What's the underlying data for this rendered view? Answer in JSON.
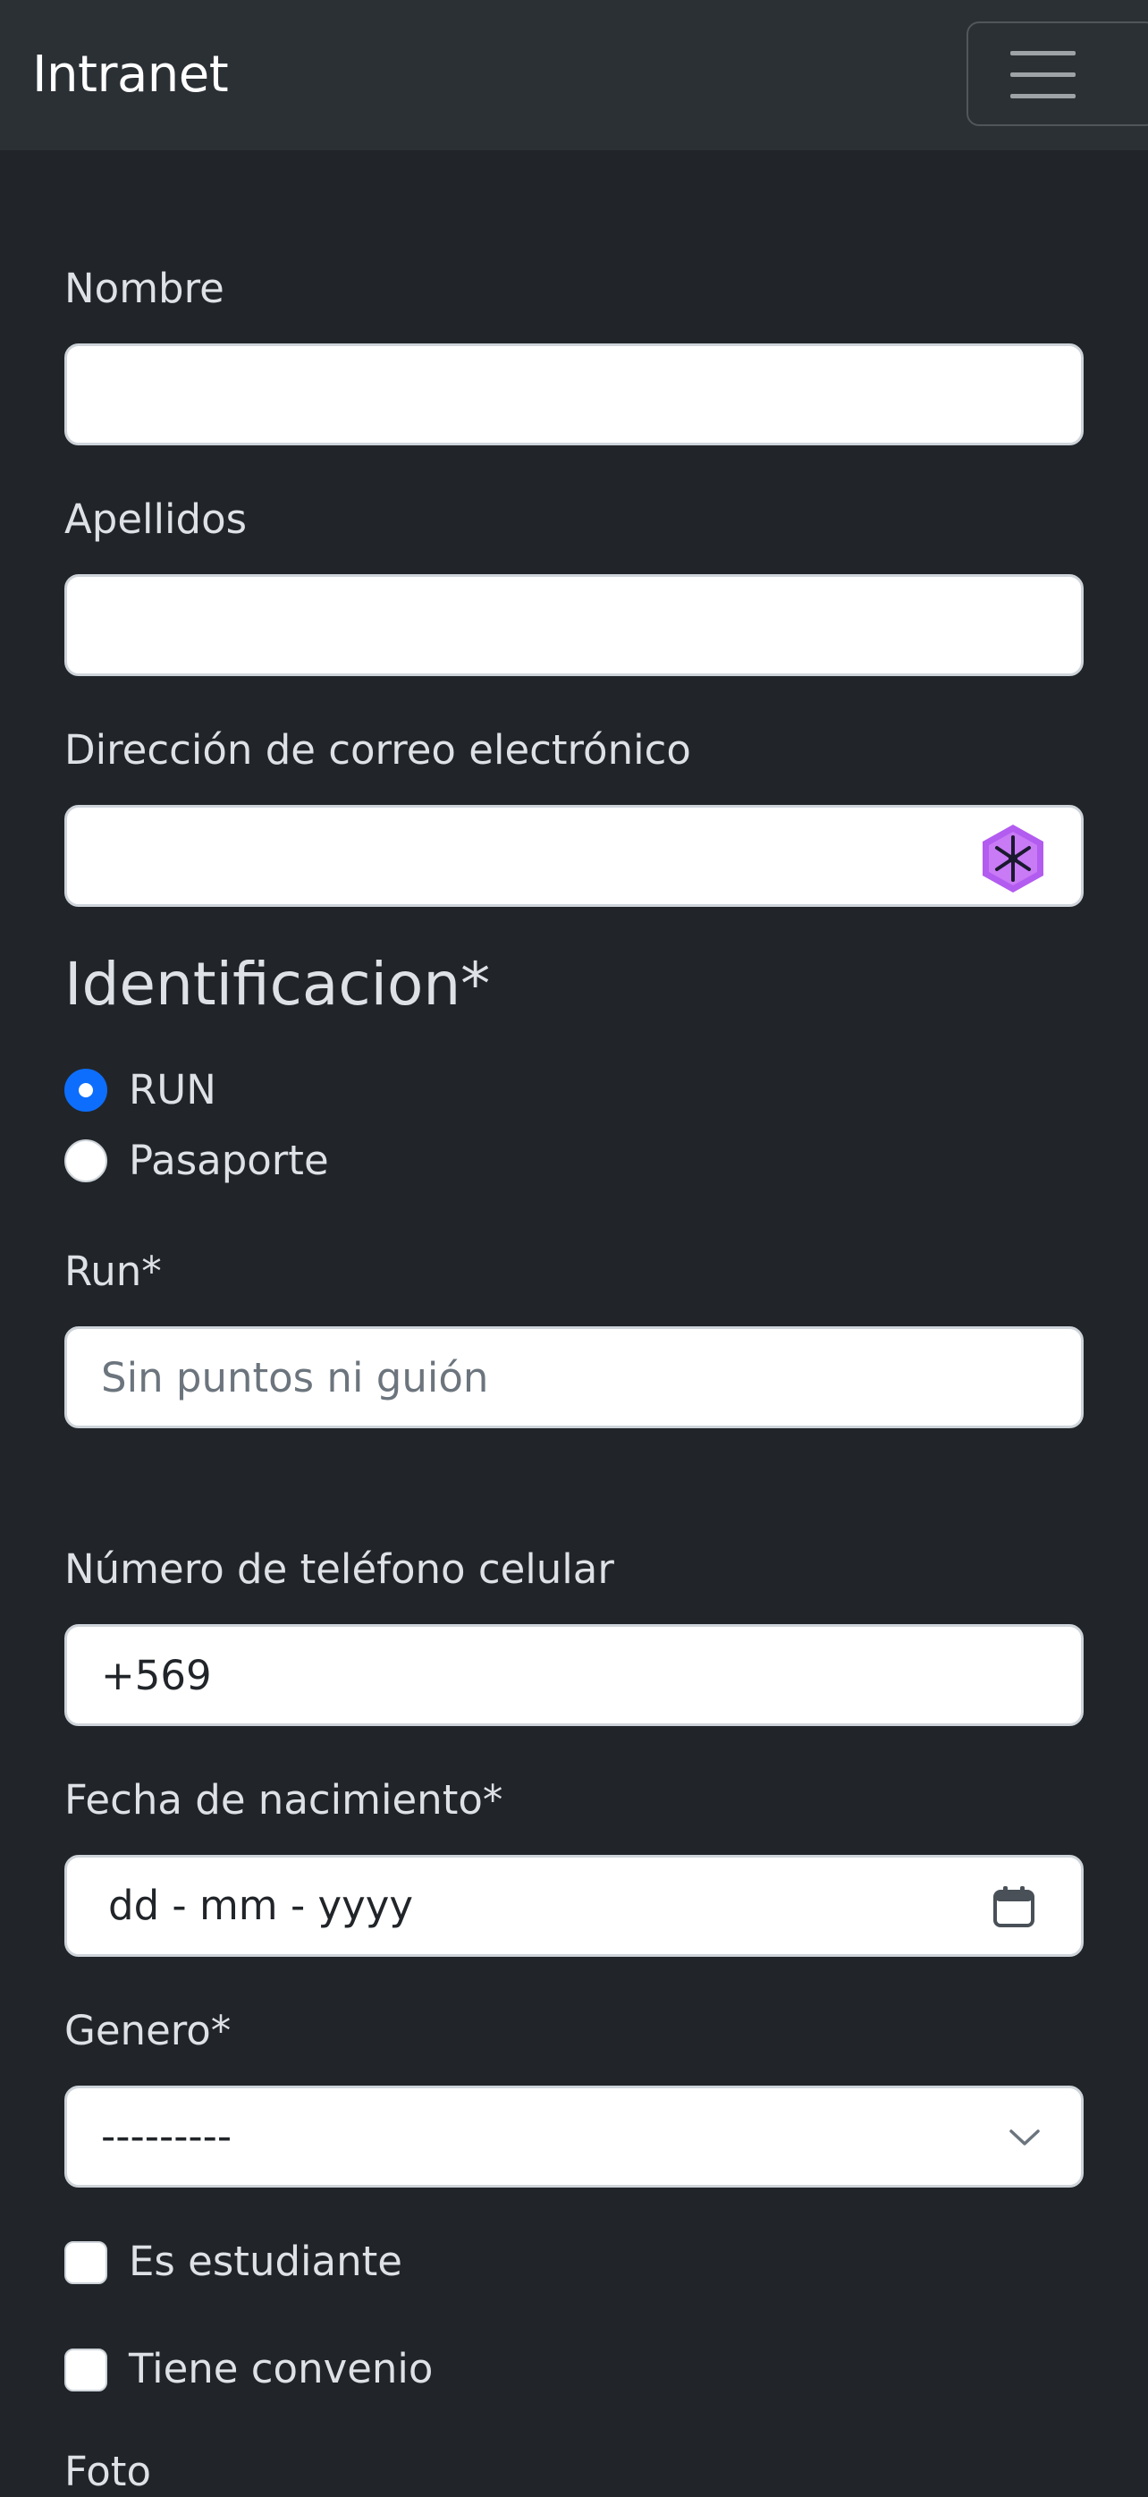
{
  "navbar": {
    "brand": "Intranet",
    "menu_icon": "hamburger-menu-icon"
  },
  "form": {
    "nombre": {
      "label": "Nombre",
      "value": ""
    },
    "apellidos": {
      "label": "Apellidos",
      "value": ""
    },
    "email": {
      "label": "Dirección de correo electrónico",
      "value": "",
      "extension_icon": "password-manager-icon",
      "extension_color": "#b35cf0"
    },
    "identificacion": {
      "title": "Identificacion*",
      "options": [
        {
          "label": "RUN",
          "checked": true
        },
        {
          "label": "Pasaporte",
          "checked": false
        }
      ]
    },
    "run": {
      "label": "Run*",
      "placeholder": "Sin puntos ni guión",
      "value": ""
    },
    "telefono": {
      "label": "Número de teléfono celular",
      "value": "+569"
    },
    "fecha": {
      "label": "Fecha de nacimiento*",
      "placeholder": "dd - mm - yyyy",
      "icon": "calendar-icon"
    },
    "genero": {
      "label": "Genero*",
      "selected": "---------",
      "icon": "chevron-down-icon"
    },
    "es_estudiante": {
      "label": "Es estudiante",
      "checked": false
    },
    "tiene_convenio": {
      "label": "Tiene convenio",
      "checked": false
    },
    "foto": {
      "label": "Foto"
    }
  },
  "colors": {
    "background": "#212529",
    "navbar": "#2b3035",
    "accent": "#0d6efd"
  }
}
